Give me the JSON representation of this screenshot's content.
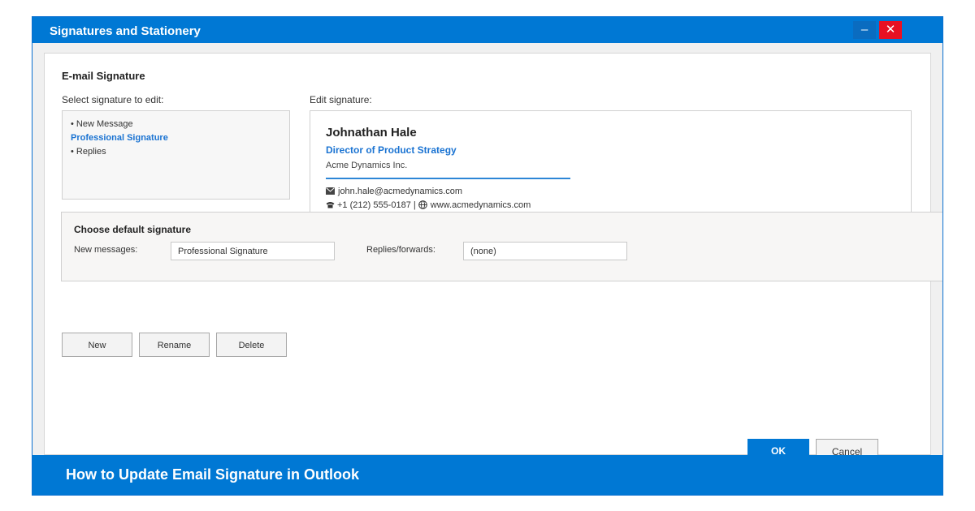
{
  "window": {
    "title": "Signatures and Stationery",
    "minimize_glyph": "–",
    "close_glyph": "✕"
  },
  "section": {
    "title": "E-mail Signature",
    "select_label": "Select signature to edit:",
    "edit_label": "Edit signature:"
  },
  "signature_list": [
    {
      "label": "• New Message",
      "selected": false
    },
    {
      "label": "Professional Signature",
      "selected": true
    },
    {
      "label": "• Replies",
      "selected": false
    }
  ],
  "signature": {
    "name": "Johnathan Hale",
    "role": "Director of Product Strategy",
    "company": "Acme Dynamics Inc.",
    "email_line": "john.hale@acmedynamics.com",
    "phone_line": "+1 (212) 555-0187 | ",
    "website": "www.acmedynamics.com",
    "email_icon": "email-icon",
    "phone_icon": "phone-icon",
    "globe_icon": "globe-icon"
  },
  "defaults": {
    "title": "Choose default signature",
    "new_messages_label": "New messages:",
    "new_messages_value": "Professional Signature",
    "replies_label": "Replies/forwards:",
    "replies_value": "(none)"
  },
  "actions": {
    "new": "New",
    "rename": "Rename",
    "delete": "Delete",
    "ok": "OK",
    "cancel": "Cancel"
  },
  "footer": {
    "text": "How to Update Email Signature in Outlook"
  },
  "colors": {
    "accent": "#0078d4",
    "link": "#1a73d2",
    "close": "#e81123"
  }
}
